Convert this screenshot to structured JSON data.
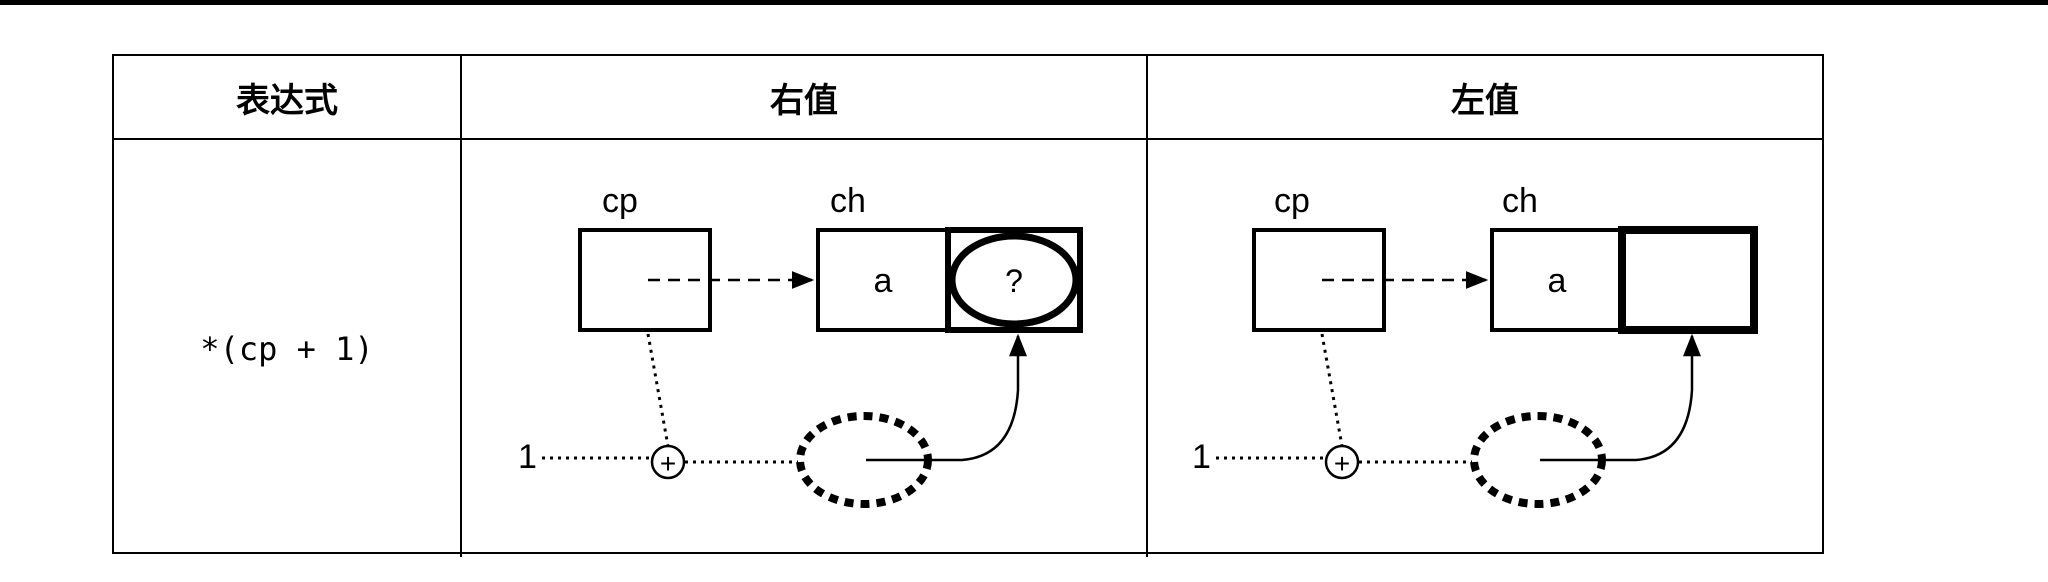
{
  "table": {
    "headers": [
      "表达式",
      "右值",
      "左值"
    ],
    "expression": "*(cp + 1)"
  },
  "rvalue_diagram": {
    "pointer_label": "cp",
    "array_label": "ch",
    "array_first_value": "a",
    "array_second_value": "?",
    "constant": "1",
    "plus": "+"
  },
  "lvalue_diagram": {
    "pointer_label": "cp",
    "array_label": "ch",
    "array_first_value": "a",
    "array_second_value": "",
    "constant": "1",
    "plus": "+"
  }
}
